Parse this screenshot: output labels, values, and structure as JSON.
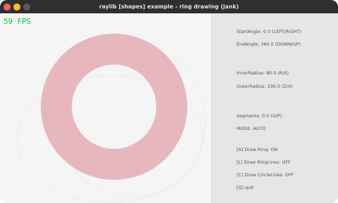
{
  "window": {
    "title": "raylib [shapes] example - ring drawing (jank)"
  },
  "canvas": {
    "fps_text": "59 FPS",
    "fps_color": "#00c83a",
    "ring_color": "#e6b7bd"
  },
  "panel": {
    "start_angle": "StartAngle: 0.0  (LEFT/RIGHT)",
    "end_angle": "EndAngle: 360.0  (DOWN/UP)",
    "inner_radius": "InnerRadius: 80.0  (R/S)",
    "outer_radius": "OuterRadius: 190.0  (Z/X)",
    "segments": "Segments: 0.0  (O/P)",
    "mode": "MODE: AUTO",
    "draw_ring": "[A] Draw Ring: ON",
    "draw_ringlines": "[L] Draw RingLines: OFF",
    "draw_circlelines": "[C] Draw CircleLines: OFF",
    "quit": "[Q] quit"
  }
}
